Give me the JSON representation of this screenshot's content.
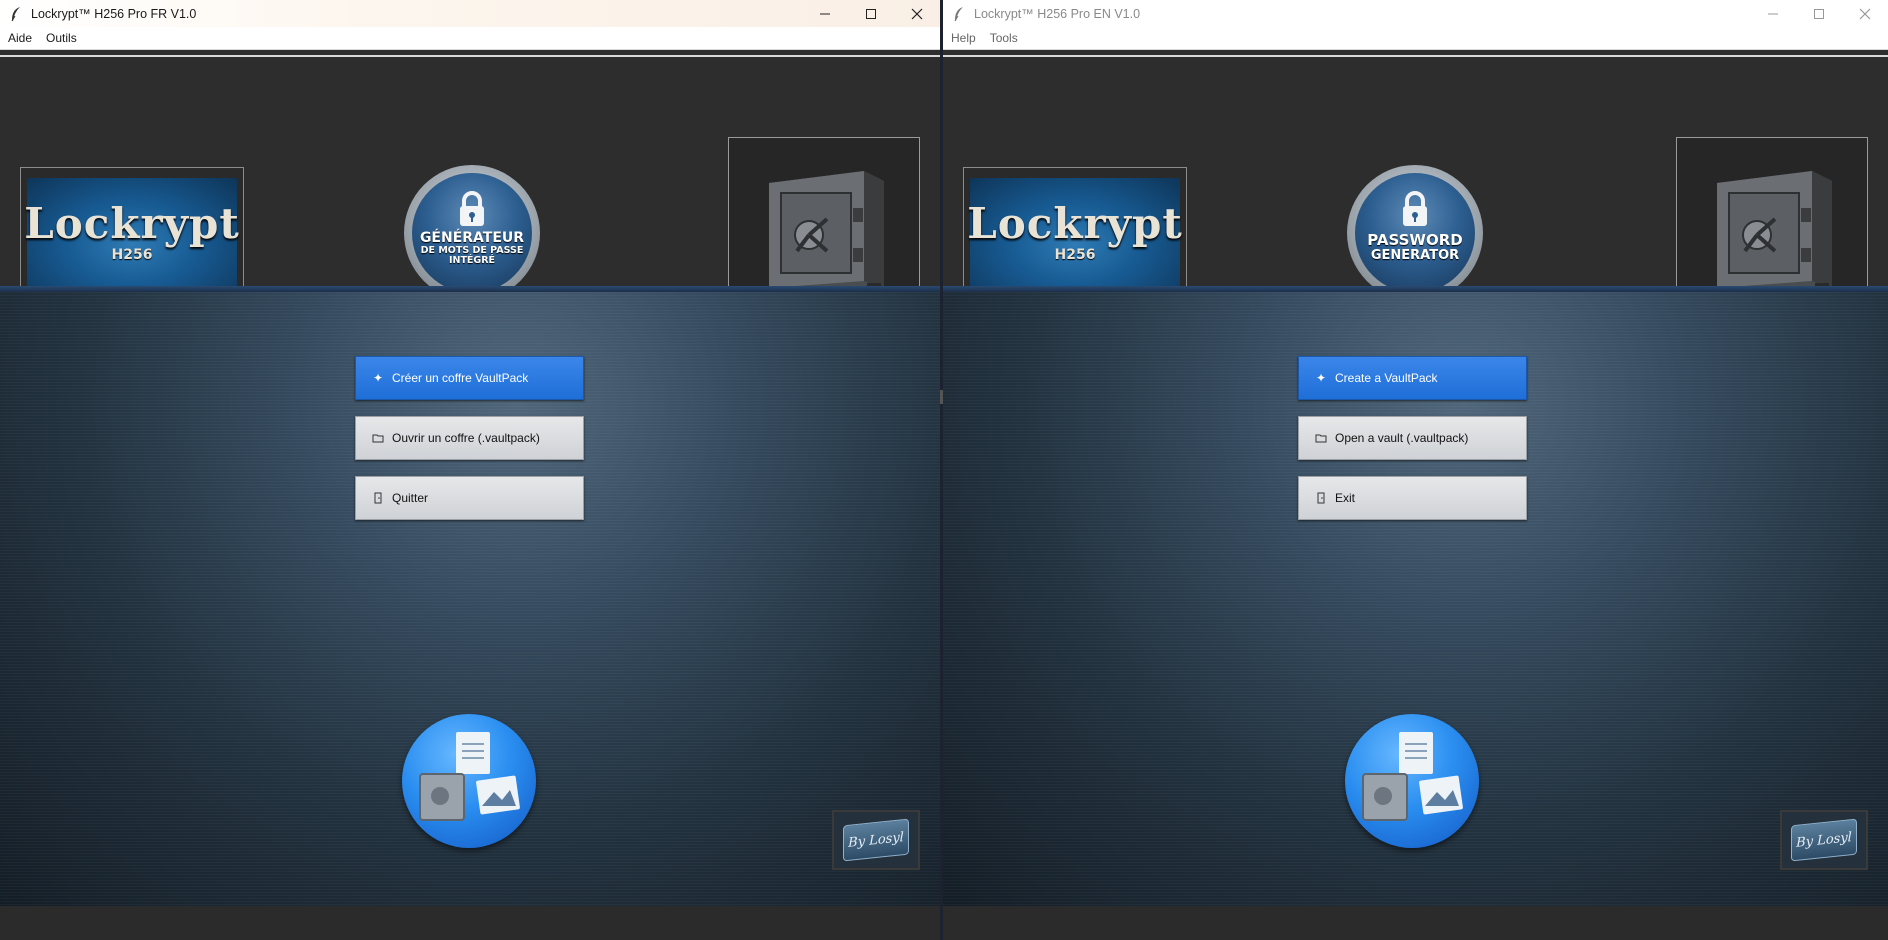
{
  "left_window": {
    "title": "Lockrypt™ H256 Pro FR V1.0",
    "menu": [
      "Aide",
      "Outils"
    ],
    "logo": {
      "name": "Lockrypt",
      "sub": "H256"
    },
    "badge": {
      "line1": "GÉNÉRATEUR",
      "line2": "DE MOTS DE PASSE",
      "line3": "INTÉGRÉ"
    },
    "buttons": {
      "create": "Créer un coffre VaultPack",
      "open": "Ouvrir un coffre (.vaultpack)",
      "quit": "Quitter"
    },
    "signature": "By Losyl"
  },
  "right_window": {
    "title": "Lockrypt™ H256 Pro EN V1.0",
    "menu": [
      "Help",
      "Tools"
    ],
    "logo": {
      "name": "Lockrypt",
      "sub": "H256"
    },
    "badge": {
      "line1": "PASSWORD",
      "line2": "GENERATOR"
    },
    "buttons": {
      "create": "Create a VaultPack",
      "open": "Open a vault (.vaultpack)",
      "quit": "Exit"
    },
    "signature": "By Losyl"
  },
  "icons": {
    "app": "feather-icon",
    "minimize": "minimize-icon",
    "maximize": "maximize-icon",
    "close": "close-icon",
    "create": "plus-icon",
    "open": "folder-icon",
    "quit": "door-icon",
    "safe": "safe-icon",
    "files": "files-safe-icon",
    "badge_lock": "padlock-icon"
  },
  "colors": {
    "primary_button": "#1f6fd8",
    "accent_bar": "#2a4a72",
    "header_bg": "#2d2d2d"
  }
}
